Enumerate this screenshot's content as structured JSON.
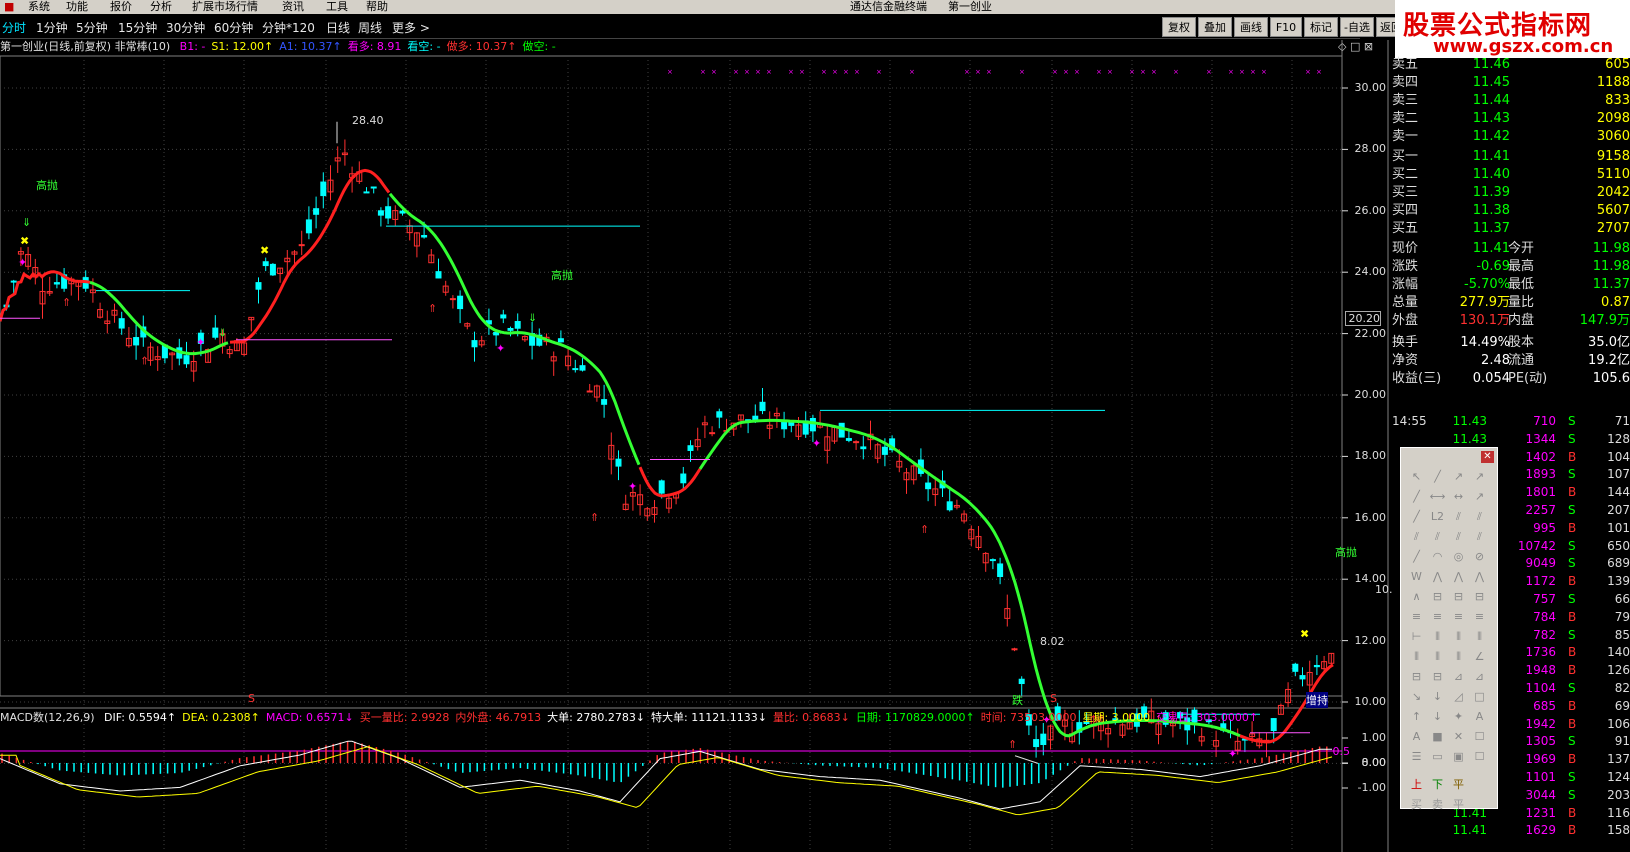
{
  "menu": {
    "app_logo_icon": "tdx-logo-icon",
    "items": [
      "系统",
      "功能",
      "报价",
      "分析",
      "扩展市场行情",
      "资讯",
      "工具",
      "帮助"
    ],
    "title": "通达信金融终端",
    "stock_short": "第一创业"
  },
  "periods": {
    "items": [
      "分时",
      "1分钟",
      "5分钟",
      "15分钟",
      "30分钟",
      "60分钟",
      "分钟*120",
      "日线",
      "周线",
      "更多 >"
    ],
    "active": "分时"
  },
  "right_buttons": [
    "复权",
    "叠加",
    "画线",
    "F10",
    "标记",
    "-自选",
    "返回"
  ],
  "logo": {
    "line1": "股票公式指标网",
    "line2": "www.gszx.com.cn"
  },
  "indicator_line": {
    "name": "第一创业(日线,前复权) 非常棒(10)",
    "items": [
      {
        "text": "B1: -",
        "color": "#ff00ff"
      },
      {
        "text": "S1: 12.00↑",
        "color": "#ffff00"
      },
      {
        "text": "A1: 10.37↑",
        "color": "#3355ff"
      },
      {
        "text": "看多: 8.91",
        "color": "#ff00ff"
      },
      {
        "text": "看空: -",
        "color": "#00ffff"
      },
      {
        "text": "做多: 10.37↑",
        "color": "#ff3030"
      },
      {
        "text": "做空: -",
        "color": "#00ff00"
      }
    ]
  },
  "price_axis": {
    "ticks": [
      "30.00",
      "28.00",
      "26.00",
      "24.00",
      "22.00",
      "20.00",
      "18.00",
      "16.00",
      "14.00",
      "12.00",
      "10.00",
      "8.00"
    ],
    "marker": "20.20",
    "cursor_value": "10."
  },
  "chart_labels": {
    "high": "28.40",
    "low": "8.02",
    "sell_tag": "高抛",
    "bottom_tag1": "跌",
    "bottom_tag2": "S",
    "bottom_tag3": "S",
    "bottom_tag4": "增持"
  },
  "macd_line": {
    "name": "MACD数(12,26,9)",
    "items": [
      {
        "text": "DIF: 0.5594↑",
        "color": "#ffffff"
      },
      {
        "text": "DEA: 0.2308↑",
        "color": "#ffff00"
      },
      {
        "text": "MACD: 0.6571↓",
        "color": "#ff00ff"
      },
      {
        "text": "买一量比: 2.9928",
        "color": "#ff3030"
      },
      {
        "text": "内外盘: 46.7913",
        "color": "#ff3030"
      },
      {
        "text": "大单: 2780.2783↓",
        "color": "#ffffff"
      },
      {
        "text": "特大单: 11121.1133↓",
        "color": "#ffffff"
      },
      {
        "text": "量比: 0.8683↓",
        "color": "#ff3030"
      },
      {
        "text": "日期: 1170829.0000↑",
        "color": "#00ff00"
      },
      {
        "text": "时间: 73503.0000",
        "color": "#ff3030"
      },
      {
        "text": "星期: 3.0000",
        "color": "#ffff00"
      },
      {
        "text": "交易日: 303.0000↑",
        "color": "#ff00ff"
      }
    ]
  },
  "macd_axis": {
    "ticks": [
      "1.00",
      "0.00",
      "-1.00"
    ],
    "marker": "0.5"
  },
  "order_book": [
    {
      "label": "卖五",
      "price": "11.46",
      "vol": "605"
    },
    {
      "label": "卖四",
      "price": "11.45",
      "vol": "1188"
    },
    {
      "label": "卖三",
      "price": "11.44",
      "vol": "833"
    },
    {
      "label": "卖二",
      "price": "11.43",
      "vol": "2098"
    },
    {
      "label": "卖一",
      "price": "11.42",
      "vol": "3060"
    },
    {
      "label": "买一",
      "price": "11.41",
      "vol": "9158"
    },
    {
      "label": "买二",
      "price": "11.40",
      "vol": "5110"
    },
    {
      "label": "买三",
      "price": "11.39",
      "vol": "2042"
    },
    {
      "label": "买四",
      "price": "11.38",
      "vol": "5607"
    },
    {
      "label": "买五",
      "price": "11.37",
      "vol": "2707"
    }
  ],
  "stats": [
    {
      "l1": "现价",
      "v1": "11.41",
      "c1": "#00ff00",
      "l2": "今开",
      "v2": "11.98",
      "c2": "#00ff00"
    },
    {
      "l1": "涨跌",
      "v1": "-0.69",
      "c1": "#00ff00",
      "l2": "最高",
      "v2": "11.98",
      "c2": "#00ff00"
    },
    {
      "l1": "涨幅",
      "v1": "-5.70%",
      "c1": "#00ff00",
      "l2": "最低",
      "v2": "11.37",
      "c2": "#00ff00"
    },
    {
      "l1": "总量",
      "v1": "277.9万",
      "c1": "#ffff00",
      "l2": "量比",
      "v2": "0.87",
      "c2": "#ffff00"
    },
    {
      "l1": "外盘",
      "v1": "130.1万",
      "c1": "#ff3030",
      "l2": "内盘",
      "v2": "147.9万",
      "c2": "#00ff00"
    },
    {
      "l1": "换手",
      "v1": "14.49%",
      "c1": "#ffffff",
      "l2": "股本",
      "v2": "35.0亿",
      "c2": "#ffffff"
    },
    {
      "l1": "净资",
      "v1": "2.48",
      "c1": "#ffffff",
      "l2": "流通",
      "v2": "19.2亿",
      "c2": "#ffffff"
    },
    {
      "l1": "收益(三)",
      "v1": "0.054",
      "c1": "#ffffff",
      "l2": "PE(动)",
      "v2": "105.6",
      "c2": "#ffffff"
    }
  ],
  "ticks": [
    {
      "t": "14:55",
      "p": "11.43",
      "v": "710",
      "bs": "S",
      "x": "71"
    },
    {
      "t": "",
      "p": "11.43",
      "v": "1344",
      "bs": "S",
      "x": "128"
    },
    {
      "t": "",
      "p": "11.42",
      "v": "1402",
      "bs": "B",
      "x": "104"
    },
    {
      "t": "",
      "p": "11.41",
      "v": "1893",
      "bs": "S",
      "x": "107"
    },
    {
      "t": "",
      "p": "11.41",
      "v": "1801",
      "bs": "B",
      "x": "144"
    },
    {
      "t": "",
      "p": "11.41",
      "v": "2257",
      "bs": "S",
      "x": "207"
    },
    {
      "t": "",
      "p": "11.41",
      "v": "995",
      "bs": "B",
      "x": "101"
    },
    {
      "t": "",
      "p": "11.41",
      "v": "10742",
      "bs": "S",
      "x": "650"
    },
    {
      "t": "",
      "p": "11.41",
      "v": "9049",
      "bs": "S",
      "x": "689"
    },
    {
      "t": "",
      "p": "11.41",
      "v": "1172",
      "bs": "B",
      "x": "139"
    },
    {
      "t": "",
      "p": "11.41",
      "v": "757",
      "bs": "S",
      "x": "66"
    },
    {
      "t": "",
      "p": "11.41",
      "v": "784",
      "bs": "B",
      "x": "79"
    },
    {
      "t": "",
      "p": "11.41",
      "v": "782",
      "bs": "S",
      "x": "85"
    },
    {
      "t": "",
      "p": "11.41",
      "v": "1736",
      "bs": "B",
      "x": "140"
    },
    {
      "t": "",
      "p": "11.41",
      "v": "1948",
      "bs": "B",
      "x": "126"
    },
    {
      "t": "",
      "p": "11.41",
      "v": "1104",
      "bs": "S",
      "x": "82"
    },
    {
      "t": "",
      "p": "11.41",
      "v": "685",
      "bs": "B",
      "x": "69"
    },
    {
      "t": "",
      "p": "11.41",
      "v": "1942",
      "bs": "B",
      "x": "106"
    },
    {
      "t": "",
      "p": "11.41",
      "v": "1305",
      "bs": "S",
      "x": "91"
    },
    {
      "t": "",
      "p": "11.41",
      "v": "1969",
      "bs": "B",
      "x": "137"
    },
    {
      "t": "",
      "p": "11.41",
      "v": "1101",
      "bs": "S",
      "x": "124"
    },
    {
      "t": "",
      "p": "11.40",
      "v": "3044",
      "bs": "S",
      "x": "203"
    },
    {
      "t": "",
      "p": "11.41",
      "v": "1231",
      "bs": "B",
      "x": "116"
    },
    {
      "t": "",
      "p": "11.41",
      "v": "1629",
      "bs": "B",
      "x": "158"
    }
  ],
  "toolbox": {
    "close_icon": "close-icon",
    "bottom_labels": [
      "上",
      "下",
      "平",
      "买",
      "卖",
      "平"
    ]
  },
  "colors": {
    "up": "#ff3030",
    "down": "#00ffff",
    "ma_up": "#ff2020",
    "ma_down": "#33ff33",
    "accent": "#ff00ff"
  }
}
